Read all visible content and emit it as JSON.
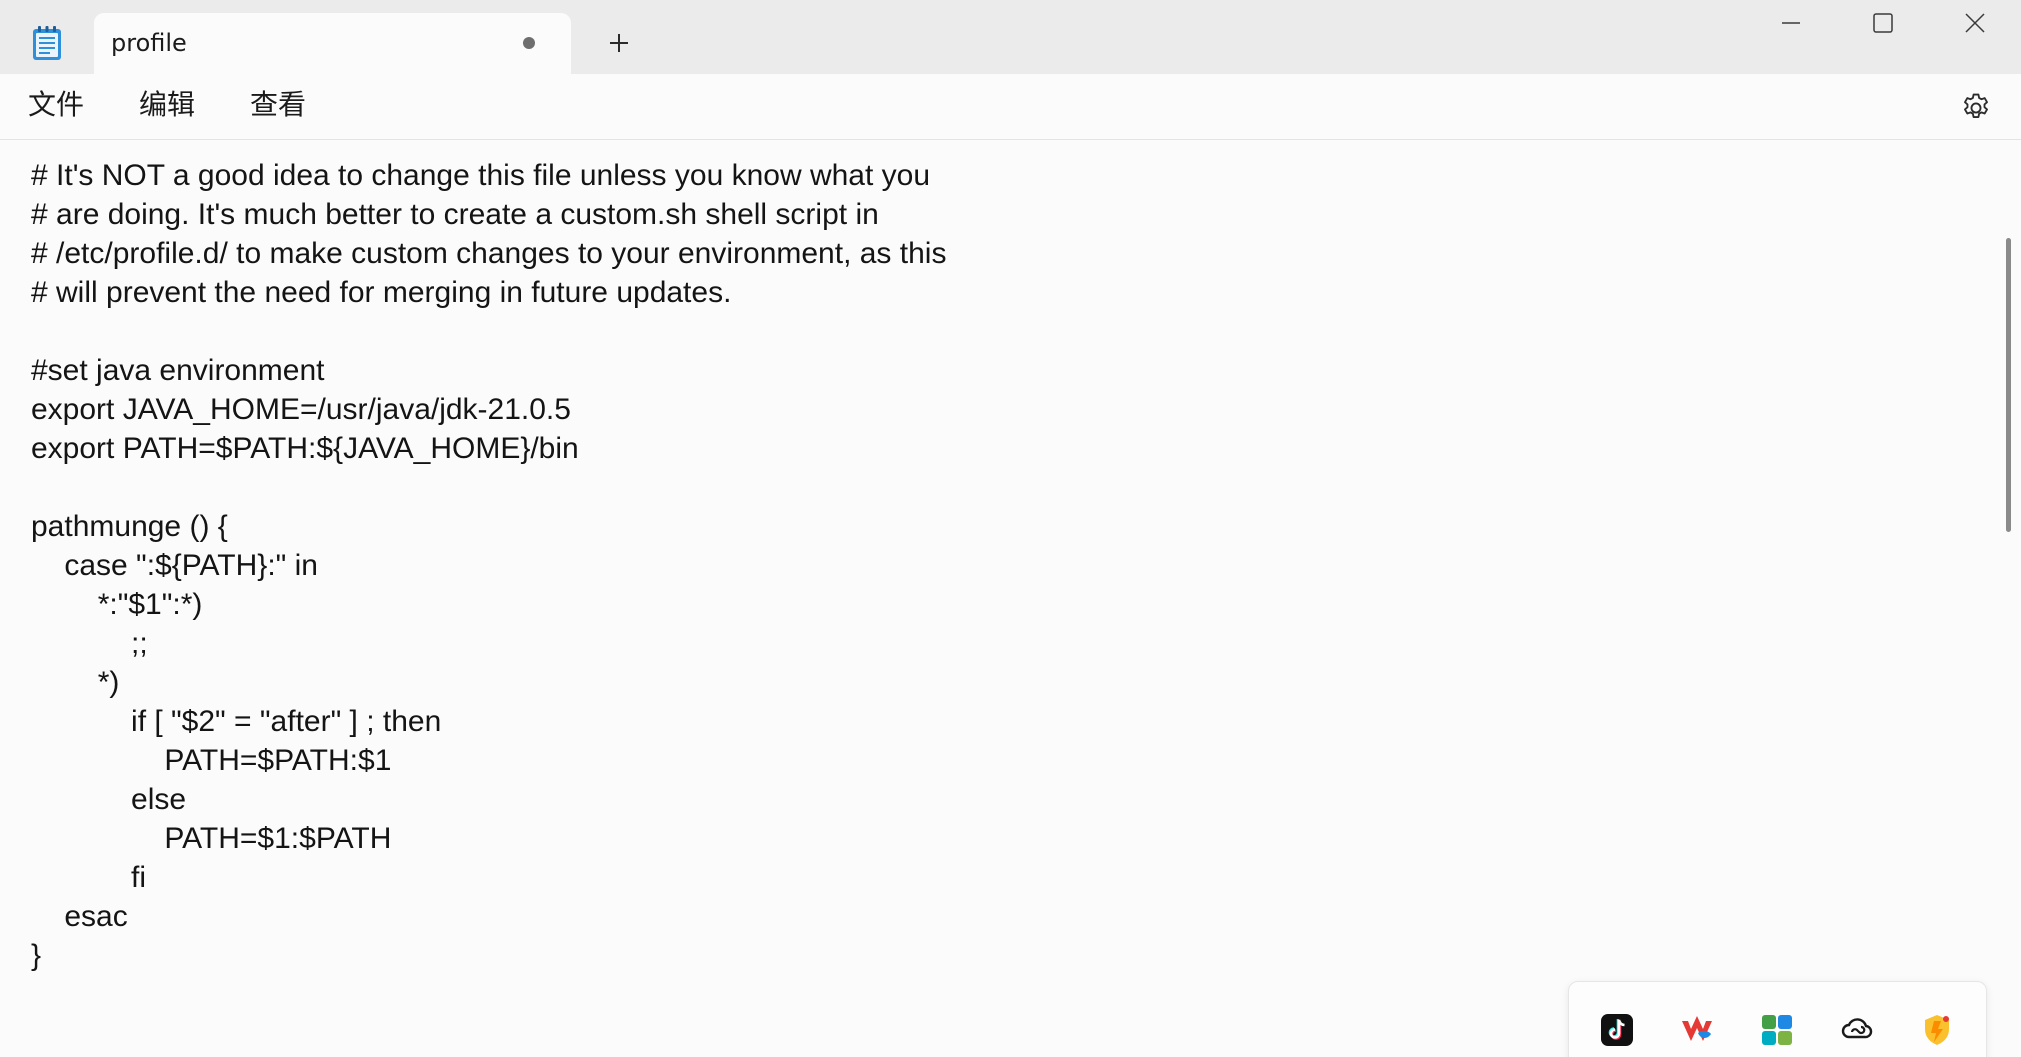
{
  "window": {
    "tab_title": "profile",
    "tab_status": "unsaved-dot",
    "new_tab_icon": "plus-icon",
    "controls": [
      "minimize-icon",
      "maximize-icon",
      "close-icon"
    ]
  },
  "menu": {
    "file": "文件",
    "edit": "编辑",
    "view": "查看",
    "settings_icon": "gear-icon"
  },
  "editor": {
    "lines": [
      "# It's NOT a good idea to change this file unless you know what you",
      "# are doing. It's much better to create a custom.sh shell script in",
      "# /etc/profile.d/ to make custom changes to your environment, as this",
      "# will prevent the need for merging in future updates.",
      "",
      "#set java environment",
      "export JAVA_HOME=/usr/java/jdk-21.0.5",
      "export PATH=$PATH:${JAVA_HOME}/bin",
      "",
      "pathmunge () {",
      "\tcase \":${PATH}:\" in",
      "\t\t*:\"$1\":*)",
      "\t\t\t;;",
      "\t\t*)",
      "\t\t\tif [ \"$2\" = \"after\" ] ; then",
      "\t\t\t\tPATH=$PATH:$1",
      "\t\t\telse",
      "\t\t\t\tPATH=$1:$PATH",
      "\t\t\tfi",
      "\tesac",
      "}"
    ]
  },
  "tray": {
    "icons": [
      "tiktok-icon",
      "wps-office-icon",
      "app-grid-icon",
      "creative-cloud-icon",
      "shield-app-icon"
    ]
  },
  "colors": {
    "titlebar_bg": "#ebebeb",
    "content_bg": "#fbfbfb",
    "text": "#141414",
    "notepad_icon_blue": "#2f8fd8"
  }
}
